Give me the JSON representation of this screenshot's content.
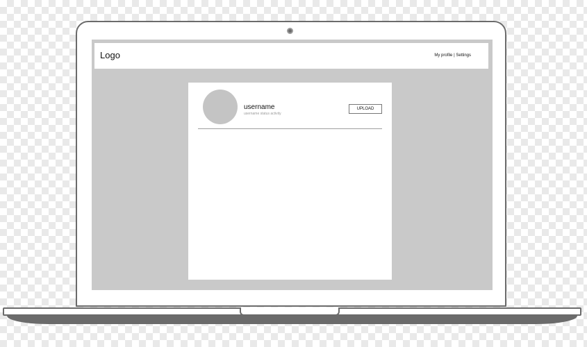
{
  "header": {
    "logo": "Logo",
    "nav_my_profile": "My profile",
    "nav_separator": " | ",
    "nav_settings": "Settings"
  },
  "profile": {
    "username": "username",
    "status": "username status activity",
    "upload_label": "UPLOAD"
  },
  "colors": {
    "screen_bg": "#c9c9c9",
    "device_outline": "#6b6b6b",
    "avatar": "#c4c4c4"
  }
}
